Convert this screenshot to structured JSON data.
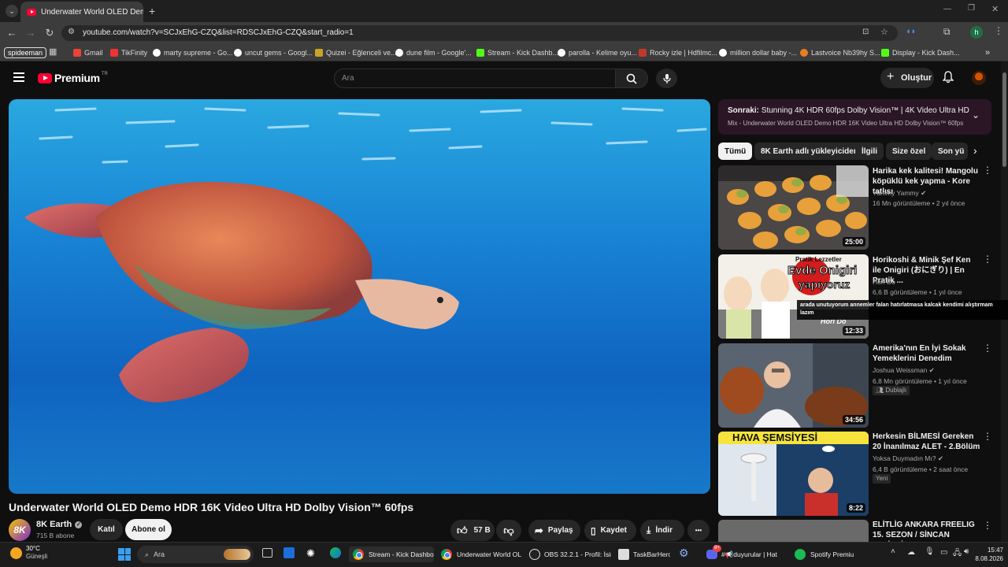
{
  "browser": {
    "tab_title": "Underwater World OLED Demo",
    "url": "youtube.com/watch?v=SCJxEhG-CZQ&list=RDSCJxEhG-CZQ&start_radio=1",
    "profile_chip": "spideeman",
    "profile_letter": "h",
    "bookmarks": [
      "Gmail",
      "TikFinity",
      "marty supreme - Go...",
      "uncut gems - Googl...",
      "Quizei - Eğlenceli ve...",
      "dune film - Google'...",
      "Stream - Kick Dashb...",
      "parolla - Kelime oyu...",
      "Rocky izle | Hdfilmc...",
      "million dollar baby -...",
      "Lastvoice Nb39hy S...",
      "Display - Kick Dash..."
    ],
    "more_bookmarks": "»"
  },
  "youtube": {
    "logo_text": "Premium",
    "region": "TR",
    "search_placeholder": "Ara",
    "create_label": "Oluştur"
  },
  "video": {
    "title": "Underwater World OLED Demo HDR 16K Video Ultra HD Dolby Vision™ 60fps",
    "channel": "8K Earth",
    "channel_avatar_text": "8K",
    "subscribers": "715 B abone",
    "join_label": "Katıl",
    "subscribe_label": "Abone ol",
    "likes": "57 B",
    "share_label": "Paylaş",
    "save_label": "Kaydet",
    "download_label": "İndir",
    "more_label": "•••"
  },
  "up_next": {
    "prefix": "Sonraki:",
    "title": "Stunning 4K HDR 60fps Dolby Vision™ | 4K Video Ultra HD",
    "mix": "Mix - Underwater World OLED Demo HDR 16K Video Ultra HD Dolby Vision™ 60fps"
  },
  "chips": [
    "Tümü",
    "8K Earth adlı yükleyiciden",
    "İlgili",
    "Size özel",
    "Son yü"
  ],
  "related": [
    {
      "title": "Harika kek kalitesi! Mangolu köpüklü kek yapma - Kore tatlısı",
      "channel": "Yummy Yammy",
      "meta": "16 Mn görüntüleme • 2 yıl önce",
      "duration": "25:00",
      "badge": ""
    },
    {
      "title": "Horikoshi & Minik Şef Ken ile Onigiri (おにぎり) | En Pratik ...",
      "channel": "Hori Do",
      "meta": "6,6 B görüntüleme • 1 yıl önce",
      "duration": "12:33",
      "badge": ""
    },
    {
      "title": "Amerika'nın En İyi Sokak Yemeklerini Denedim",
      "channel": "Joshua Weissman",
      "meta": "6,8 Mn görüntüleme • 1 yıl önce",
      "duration": "34:56",
      "badge": "Dublajlı"
    },
    {
      "title": "Herkesin BİLMESİ Gereken 20 İnanılmaz ALET - 2.Bölüm",
      "channel": "Yoksa Duymadın Mı?",
      "meta": "6,4 B görüntüleme • 2 saat önce",
      "duration": "8:22",
      "badge": "Yeni"
    },
    {
      "title": "ELİTLİG ANKARA FREELIG 15. SEZON / SİNCAN LEVİSKİ - N...",
      "channel": "",
      "meta": "",
      "duration": "",
      "badge": ""
    }
  ],
  "thumb_texts": {
    "t2_top": "Pratik Lezzetler",
    "t2_main1": "Evde Onigiri",
    "t2_main2": "yapıyoruz",
    "t2_brand": "Hori Do",
    "t4_banner": "HAVA ŞEMSİYESİ"
  },
  "chat_overlay": "arada unutuyorum annemler falan hatırlatmasa kalcak kendimi alıştırmam lazım",
  "taskbar": {
    "temp": "30°C",
    "weather": "Güneşli",
    "search": "Ara",
    "apps": [
      "Stream - Kick Dashbo",
      "Underwater World OL",
      "OBS 32.2.1 - Profil: İsir",
      "TaskBarHero",
      "#📢duyurular | Hat",
      "Spotify Premium"
    ],
    "discord_badge": "9+",
    "time": "15:47",
    "date": "8.08.2026"
  },
  "colors": {
    "youtube_red": "#ff0033",
    "accent_green": "#53fc18"
  }
}
